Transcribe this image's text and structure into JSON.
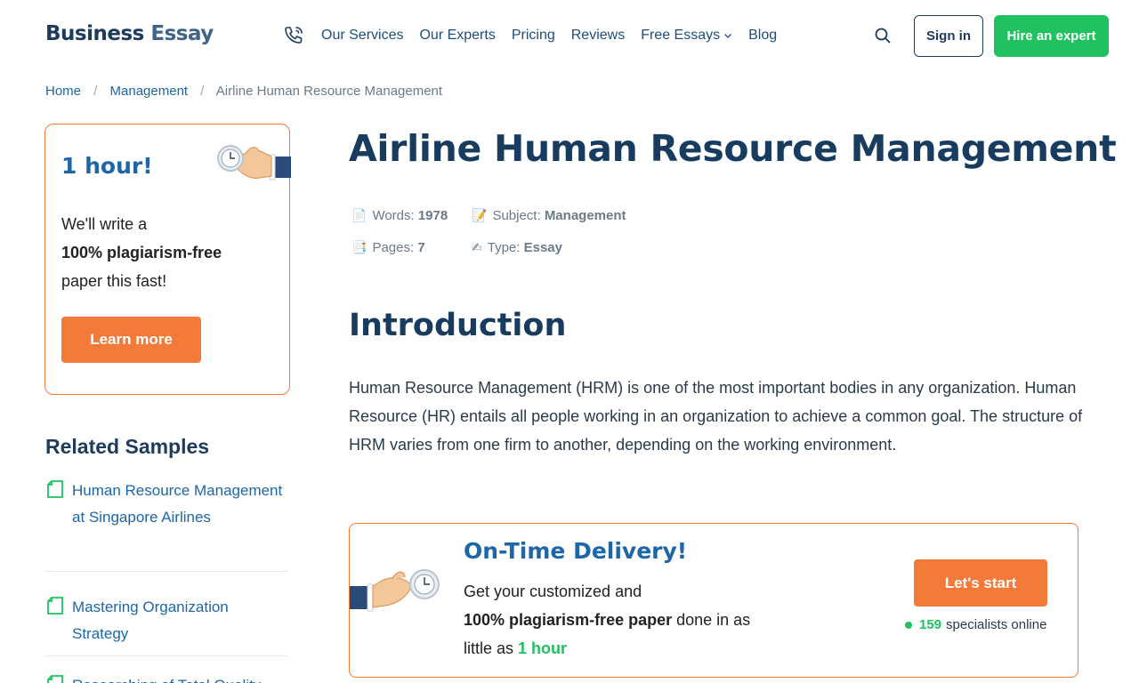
{
  "header": {
    "logo_word1": "Business",
    "logo_word2": "Essay",
    "nav": [
      "Our Services",
      "Our Experts",
      "Pricing",
      "Reviews",
      "Free Essays",
      "Blog"
    ],
    "signin_label": "Sign in",
    "hire_label": "Hire an expert"
  },
  "breadcrumb": {
    "home": "Home",
    "category": "Management",
    "current": "Airline Human Resource Management",
    "separator": "/"
  },
  "promo": {
    "title": "1 hour!",
    "line1": "We'll write a",
    "line2": "100% plagiarism-free",
    "line3": "paper this fast!",
    "button": "Learn more"
  },
  "related": {
    "title": "Related Samples",
    "items": [
      "Human Resource Management at Singapore Airlines",
      "Mastering Organization Strategy",
      "Researching of Total Quality"
    ]
  },
  "article": {
    "title": "Airline Human Resource Management",
    "meta": {
      "words_label": "Words:",
      "words_value": "1978",
      "subject_label": "Subject:",
      "subject_value": "Management",
      "pages_label": "Pages:",
      "pages_value": "7",
      "type_label": "Type:",
      "type_value": "Essay"
    },
    "section_title": "Introduction",
    "paragraph": "Human Resource Management (HRM) is one of the most important bodies in any organization. Human Resource (HR) entails all people working in an organization to achieve a common goal. The structure of HRM varies from one firm to another, depending on the working environment."
  },
  "banner": {
    "title": "On-Time Delivery!",
    "line1": "Get your customized and",
    "bold": "100% plagiarism-free paper",
    "line2": " done in as",
    "line3": "little as ",
    "highlight": "1 hour",
    "button": "Let's start",
    "online_count": "159",
    "online_label": "specialists online"
  },
  "colors": {
    "brand_dark": "#1d3b5c",
    "link_blue": "#1d66a8",
    "accent_orange": "#f47a3a",
    "accent_green": "#1fc25f"
  },
  "icons": [
    "phone-icon",
    "chevron-down-icon",
    "search-icon",
    "clock-hand-icon",
    "document-icon"
  ]
}
